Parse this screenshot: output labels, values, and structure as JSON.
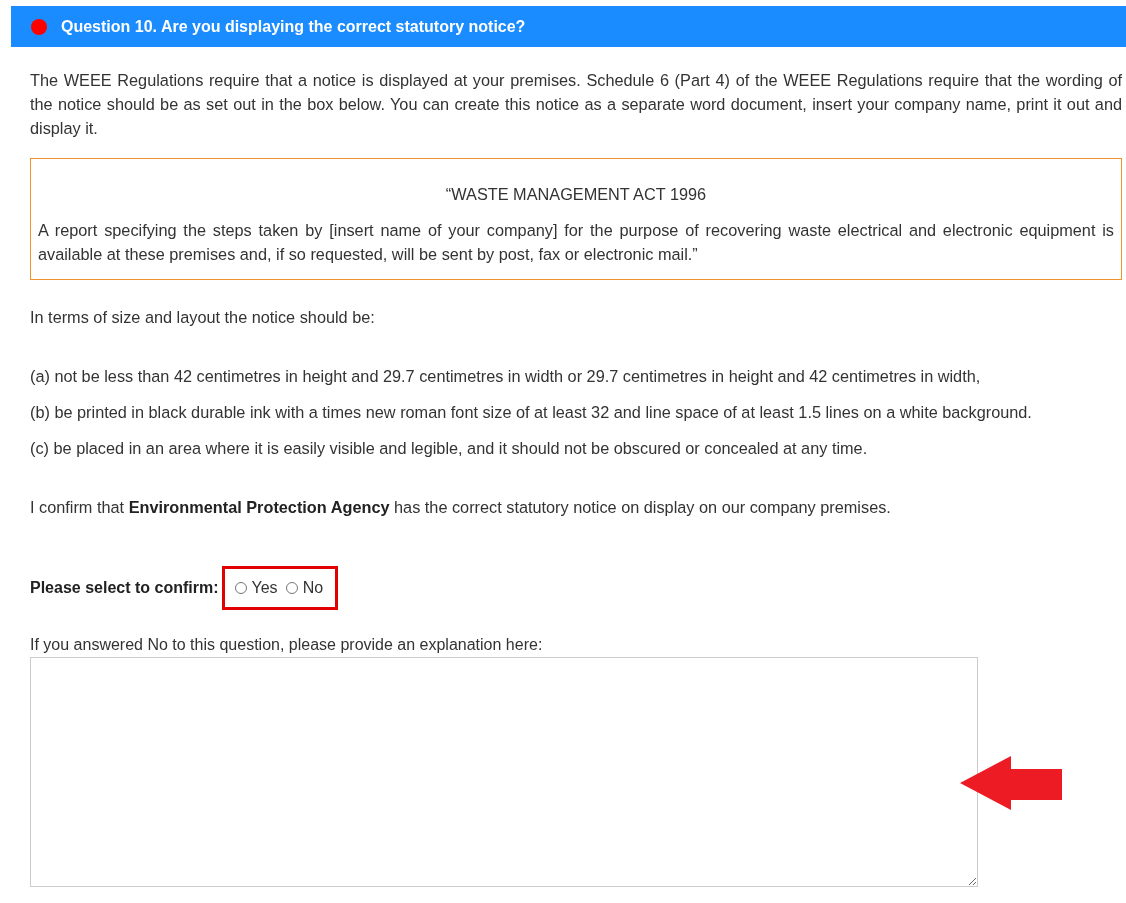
{
  "question": {
    "title": "Question 10. Are you displaying the correct statutory notice?"
  },
  "intro": "The WEEE Regulations require that a notice is displayed at your premises. Schedule 6 (Part 4) of the WEEE Regulations require that the wording of the notice should be as set out in the box below. You can create this notice as a separate word document, insert your company name, print it out and display it.",
  "notice": {
    "heading": "“WASTE MANAGEMENT ACT 1996",
    "body": "A report specifying the steps taken by [insert name of your company] for the purpose of recovering waste electrical and electronic equipment is available at these premises and, if so requested, will be sent by post, fax or electronic mail.”"
  },
  "size_intro": "In terms of size and layout the notice should be:",
  "requirements": [
    "(a) not be less than 42 centimetres in height and 29.7 centimetres in width or 29.7 centimetres in height and 42 centimetres in width,",
    "(b) be printed in black durable ink with a times new roman font size of at least 32 and line space of at least 1.5 lines on a white background.",
    "(c) be placed in an area where it is easily visible and legible, and it should not be obscured or concealed at any time."
  ],
  "confirmation": "I confirm that **Environmental Protection Agency** has the correct statutory notice on display on our company premises.",
  "confirm": {
    "label": "Please select to confirm:",
    "options": [
      {
        "label": "Yes",
        "selected": false
      },
      {
        "label": "No",
        "selected": false
      }
    ]
  },
  "explanation": {
    "label": "If you answered No to this question, please provide an explanation here:"
  }
}
